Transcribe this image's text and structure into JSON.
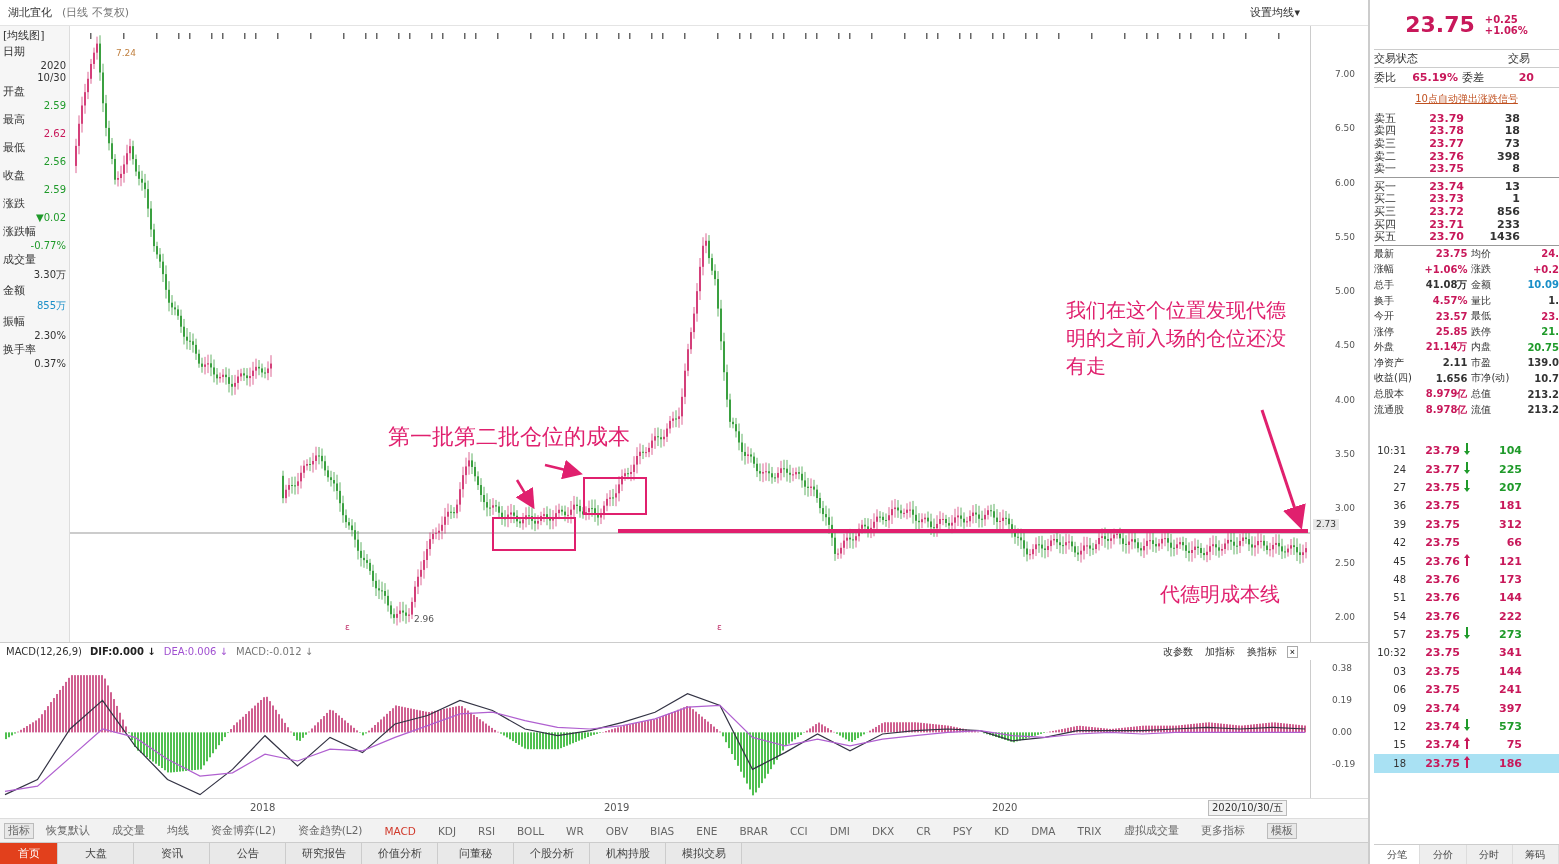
{
  "title": {
    "stock": "湖北宜化",
    "mode": "(日线 不复权)",
    "ma_button": "设置均线▾"
  },
  "info_panel": {
    "tag": "[均线图]",
    "items": [
      {
        "label": "日期",
        "values": [
          "2020",
          "10/30"
        ],
        "color": "#333333"
      },
      {
        "label": "开盘",
        "values": [
          "2.59"
        ],
        "color": "#1f9a2a"
      },
      {
        "label": "最高",
        "values": [
          "2.62"
        ],
        "color": "#c8185a"
      },
      {
        "label": "最低",
        "values": [
          "2.56"
        ],
        "color": "#1f9a2a"
      },
      {
        "label": "收盘",
        "values": [
          "2.59"
        ],
        "color": "#1f9a2a"
      },
      {
        "label": "涨跌",
        "values": [
          "▼0.02"
        ],
        "color": "#1f9a2a"
      },
      {
        "label": "涨跌幅",
        "values": [
          "-0.77%"
        ],
        "color": "#1f9a2a"
      },
      {
        "label": "成交量",
        "values": [
          "3.30万"
        ],
        "color": "#333333"
      },
      {
        "label": "金额",
        "values": [
          "855万"
        ],
        "color": "#1a8fc8"
      },
      {
        "label": "振幅",
        "values": [
          "2.30%"
        ],
        "color": "#333333"
      },
      {
        "label": "换手率",
        "values": [
          "0.37%"
        ],
        "color": "#333333"
      }
    ]
  },
  "chart": {
    "high_label": "7.24",
    "low_label": "2.96",
    "event_marks": [
      "ε",
      "ε"
    ],
    "price_axis": [
      "7.00",
      "6.50",
      "6.00",
      "5.50",
      "5.00",
      "4.50",
      "4.00",
      "3.50",
      "3.00",
      "2.50",
      "2.00"
    ],
    "price_marker": "2.73"
  },
  "macd": {
    "title": "MACD(12,26,9)",
    "values": [
      {
        "text": "DIF:0.000 ↓",
        "kind": "dif"
      },
      {
        "text": "DEA:0.006 ↓",
        "kind": "dea"
      },
      {
        "text": "MACD:-0.012 ↓",
        "kind": "macd"
      }
    ],
    "actions": [
      "改参数",
      "加指标",
      "换指标"
    ],
    "close": "×",
    "chart_data": {
      "type": "line",
      "ylim": [
        -0.39,
        0.43
      ],
      "yticks": [
        {
          "value": 0.38,
          "label": "0.38"
        },
        {
          "value": 0.19,
          "label": "0.19"
        },
        {
          "value": 0,
          "label": "0.00"
        },
        {
          "value": -0.19,
          "label": "-0.19"
        }
      ],
      "series": [
        {
          "color": "#333344",
          "values": [
            -0.37,
            -0.28,
            0.02,
            0.19,
            -0.08,
            -0.28,
            -0.37,
            -0.22,
            -0.02,
            -0.2,
            -0.03,
            -0.12,
            0.05,
            0.1,
            0.19,
            0.13,
            0.02,
            -0.02,
            0.01,
            0.06,
            0.12,
            0.23,
            0.16,
            -0.22,
            -0.12,
            -0.01,
            -0.11,
            -0.01,
            0.01,
            0.02,
            0.01,
            -0.05,
            -0.03,
            0.01,
            0.01,
            0.01,
            0.02,
            0.03,
            0.02,
            0.03,
            0.02
          ]
        },
        {
          "color": "#b060d0",
          "values": [
            -0.35,
            -0.32,
            -0.15,
            0.02,
            -0.03,
            -0.16,
            -0.26,
            -0.24,
            -0.13,
            -0.17,
            -0.1,
            -0.11,
            -0.03,
            0.04,
            0.11,
            0.12,
            0.07,
            0.03,
            0.02,
            0.04,
            0.08,
            0.15,
            0.16,
            -0.03,
            -0.08,
            -0.04,
            -0.08,
            -0.04,
            -0.02,
            0,
            0.01,
            -0.02,
            -0.03,
            -0.01,
            0,
            -0.01,
            0,
            0,
            0,
            0,
            0
          ]
        }
      ]
    }
  },
  "date_axis": {
    "years": [
      "2018",
      "2019",
      "2020"
    ],
    "current": "2020/10/30/五"
  },
  "indicator_tabs": [
    {
      "label": "指标",
      "selected": false,
      "kind": "boxed"
    },
    {
      "label": "恢复默认",
      "selected": false,
      "kind": "plain"
    },
    {
      "label": "成交量",
      "selected": false,
      "kind": "plain"
    },
    {
      "label": "均线",
      "selected": false,
      "kind": "plain"
    },
    {
      "label": "资金博弈(L2)",
      "selected": false,
      "kind": "plain"
    },
    {
      "label": "资金趋势(L2)",
      "selected": false,
      "kind": "plain"
    },
    {
      "label": "MACD",
      "selected": true,
      "kind": "plain"
    },
    {
      "label": "KDJ",
      "selected": false,
      "kind": "plain"
    },
    {
      "label": "RSI",
      "selected": false,
      "kind": "plain"
    },
    {
      "label": "BOLL",
      "selected": false,
      "kind": "plain"
    },
    {
      "label": "WR",
      "selected": false,
      "kind": "plain"
    },
    {
      "label": "OBV",
      "selected": false,
      "kind": "plain"
    },
    {
      "label": "BIAS",
      "selected": false,
      "kind": "plain"
    },
    {
      "label": "ENE",
      "selected": false,
      "kind": "plain"
    },
    {
      "label": "BRAR",
      "selected": false,
      "kind": "plain"
    },
    {
      "label": "CCI",
      "selected": false,
      "kind": "plain"
    },
    {
      "label": "DMI",
      "selected": false,
      "kind": "plain"
    },
    {
      "label": "DKX",
      "selected": false,
      "kind": "plain"
    },
    {
      "label": "CR",
      "selected": false,
      "kind": "plain"
    },
    {
      "label": "PSY",
      "selected": false,
      "kind": "plain"
    },
    {
      "label": "KD",
      "selected": false,
      "kind": "plain"
    },
    {
      "label": "DMA",
      "selected": false,
      "kind": "plain"
    },
    {
      "label": "TRIX",
      "selected": false,
      "kind": "plain"
    },
    {
      "label": "虚拟成交量",
      "selected": false,
      "kind": "plain"
    },
    {
      "label": "更多指标",
      "selected": false,
      "kind": "plain"
    },
    {
      "label": "模板",
      "selected": false,
      "kind": "boxed"
    }
  ],
  "bottom_tabs": [
    {
      "label": "首页",
      "selected": true
    },
    {
      "label": "大盘",
      "selected": false
    },
    {
      "label": "资讯",
      "selected": false
    },
    {
      "label": "公告",
      "selected": false
    },
    {
      "label": "研究报告",
      "selected": false
    },
    {
      "label": "价值分析",
      "selected": false
    },
    {
      "label": "问董秘",
      "selected": false
    },
    {
      "label": "个股分析",
      "selected": false
    },
    {
      "label": "机构持股",
      "selected": false
    },
    {
      "label": "模拟交易",
      "selected": false
    }
  ],
  "quote": {
    "price": "23.75",
    "change": "+0.25",
    "change_pct": "+1.06%",
    "status_label": "交易状态",
    "status_value": "交易",
    "ratio_label": "委比",
    "ratio_value": "65.19%",
    "diff_label": "委差",
    "diff_value": "20",
    "signal_link": "10点自动弹出涨跌信号",
    "asks": [
      {
        "label": "卖五",
        "price": "23.79",
        "volume": "38"
      },
      {
        "label": "卖四",
        "price": "23.78",
        "volume": "18"
      },
      {
        "label": "卖三",
        "price": "23.77",
        "volume": "73"
      },
      {
        "label": "卖二",
        "price": "23.76",
        "volume": "398"
      },
      {
        "label": "卖一",
        "price": "23.75",
        "volume": "8"
      }
    ],
    "bids": [
      {
        "label": "买一",
        "price": "23.74",
        "volume": "13"
      },
      {
        "label": "买二",
        "price": "23.73",
        "volume": "1"
      },
      {
        "label": "买三",
        "price": "23.72",
        "volume": "856"
      },
      {
        "label": "买四",
        "price": "23.71",
        "volume": "233"
      },
      {
        "label": "买五",
        "price": "23.70",
        "volume": "1436"
      }
    ],
    "stats": [
      [
        {
          "label": "最新",
          "value": "23.75",
          "color": "#c8185a"
        },
        {
          "label": "均价",
          "value": "24.",
          "color": "#c8185a"
        }
      ],
      [
        {
          "label": "涨幅",
          "value": "+1.06%",
          "color": "#c8185a"
        },
        {
          "label": "涨跌",
          "value": "+0.2",
          "color": "#c8185a"
        }
      ],
      [
        {
          "label": "总手",
          "value": "41.08万",
          "color": "#333333"
        },
        {
          "label": "金额",
          "value": "10.09",
          "color": "#1a8fc8"
        }
      ],
      [
        {
          "label": "换手",
          "value": "4.57%",
          "color": "#c8185a"
        },
        {
          "label": "量比",
          "value": "1.",
          "color": "#333333"
        }
      ],
      [
        {
          "label": "今开",
          "value": "23.57",
          "color": "#c8185a"
        },
        {
          "label": "最低",
          "value": "23.",
          "color": "#c8185a"
        }
      ],
      [
        {
          "label": "涨停",
          "value": "25.85",
          "color": "#c8185a"
        },
        {
          "label": "跌停",
          "value": "21.",
          "color": "#1f9a2a"
        }
      ],
      [
        {
          "label": "外盘",
          "value": "21.14万",
          "color": "#c8185a"
        },
        {
          "label": "内盘",
          "value": "20.75",
          "color": "#1f9a2a"
        }
      ],
      [
        {
          "label": "净资产",
          "value": "2.11",
          "color": "#333333"
        },
        {
          "label": "市盈",
          "value": "139.0",
          "color": "#333333"
        }
      ],
      [
        {
          "label": "收益(四)",
          "value": "1.656",
          "color": "#333333"
        },
        {
          "label": "市净(动)",
          "value": "10.7",
          "color": "#333333"
        }
      ],
      [
        {
          "label": "总股本",
          "value": "8.979亿",
          "color": "#c8185a"
        },
        {
          "label": "总值",
          "value": "213.2",
          "color": "#333333"
        }
      ],
      [
        {
          "label": "流通股",
          "value": "8.978亿",
          "color": "#c8185a"
        },
        {
          "label": "流值",
          "value": "213.2",
          "color": "#333333"
        }
      ]
    ],
    "ticks": [
      {
        "time": "10:31",
        "price": "23.79",
        "kind": "down",
        "volume": "104",
        "selected": false
      },
      {
        "time": "24",
        "price": "23.77",
        "kind": "down",
        "volume": "225",
        "selected": false
      },
      {
        "time": "27",
        "price": "23.75",
        "kind": "down",
        "volume": "207",
        "selected": false
      },
      {
        "time": "36",
        "price": "23.75",
        "kind": "flat",
        "volume": "181",
        "selected": false
      },
      {
        "time": "39",
        "price": "23.75",
        "kind": "flat",
        "volume": "312",
        "selected": false
      },
      {
        "time": "42",
        "price": "23.75",
        "kind": "flat",
        "volume": "66",
        "selected": false
      },
      {
        "time": "45",
        "price": "23.76",
        "kind": "up",
        "volume": "121",
        "selected": false
      },
      {
        "time": "48",
        "price": "23.76",
        "kind": "flat",
        "volume": "173",
        "selected": false
      },
      {
        "time": "51",
        "price": "23.76",
        "kind": "flat",
        "volume": "144",
        "selected": false
      },
      {
        "time": "54",
        "price": "23.76",
        "kind": "flat",
        "volume": "222",
        "selected": false
      },
      {
        "time": "57",
        "price": "23.75",
        "kind": "down",
        "volume": "273",
        "selected": false
      },
      {
        "time": "10:32",
        "price": "23.75",
        "kind": "flat",
        "volume": "341",
        "selected": false
      },
      {
        "time": "03",
        "price": "23.75",
        "kind": "flat",
        "volume": "144",
        "selected": false
      },
      {
        "time": "06",
        "price": "23.75",
        "kind": "flat",
        "volume": "241",
        "selected": false
      },
      {
        "time": "09",
        "price": "23.74",
        "kind": "flat",
        "volume": "397",
        "selected": false
      },
      {
        "time": "12",
        "price": "23.74",
        "kind": "down",
        "volume": "573",
        "selected": false
      },
      {
        "time": "15",
        "price": "23.74",
        "kind": "up",
        "volume": "75",
        "selected": false
      },
      {
        "time": "18",
        "price": "23.75",
        "kind": "up",
        "volume": "186",
        "selected": true
      }
    ],
    "tabs": [
      {
        "label": "分笔",
        "selected": true
      },
      {
        "label": "分价",
        "selected": false
      },
      {
        "label": "分时",
        "selected": false
      },
      {
        "label": "筹码",
        "selected": false
      }
    ]
  },
  "annotations": {
    "box_note": "第一批第二批仓位的成本",
    "main_note": "我们在这个位置发现代德明的之前入场的仓位还没有走",
    "line_note": "代德明成本线"
  }
}
